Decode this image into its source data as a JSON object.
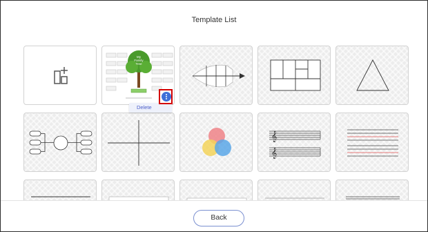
{
  "header": {
    "title": "Template List"
  },
  "templates": [
    {
      "name": "New Template",
      "icon": "add-template-icon"
    },
    {
      "name": "My Family Tree",
      "thumb_text": [
        "My",
        "Family",
        "Tree"
      ]
    },
    {
      "name": "Fishbone"
    },
    {
      "name": "Grid Layout"
    },
    {
      "name": "Triangle"
    },
    {
      "name": "Mind Map"
    },
    {
      "name": "Cross Axis"
    },
    {
      "name": "Venn Circles"
    },
    {
      "name": "Music Staff"
    },
    {
      "name": "Writing Lines"
    }
  ],
  "context_menu": {
    "delete_label": "Delete"
  },
  "footer": {
    "back_label": "Back"
  },
  "colors": {
    "accent": "#3f6fd8",
    "highlight": "#d40000",
    "tree": "#4a9a2c"
  }
}
